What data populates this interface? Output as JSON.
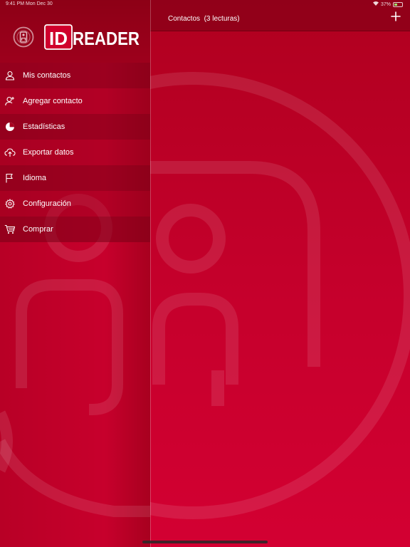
{
  "status_bar": {
    "time": "9:41 PM  Mon Dec 30",
    "battery": "37%"
  },
  "navbar": {
    "title": "Contactos  (3 lecturas)",
    "add_icon": "plus-icon"
  },
  "brand": {
    "logo_text": "IDREADER",
    "accent": "#c0002a",
    "header_color": "#8d0016"
  },
  "menu": {
    "items": [
      {
        "label": "Mis contactos",
        "icon": "person-icon"
      },
      {
        "label": "Agregar contacto",
        "icon": "add-person-icon"
      },
      {
        "label": "Estadísticas",
        "icon": "pie-chart-icon"
      },
      {
        "label": "Exportar datos",
        "icon": "cloud-upload-icon"
      },
      {
        "label": "Idioma",
        "icon": "flag-icon"
      },
      {
        "label": "Configuración",
        "icon": "gear-icon"
      },
      {
        "label": "Comprar",
        "icon": "cart-icon"
      }
    ]
  }
}
